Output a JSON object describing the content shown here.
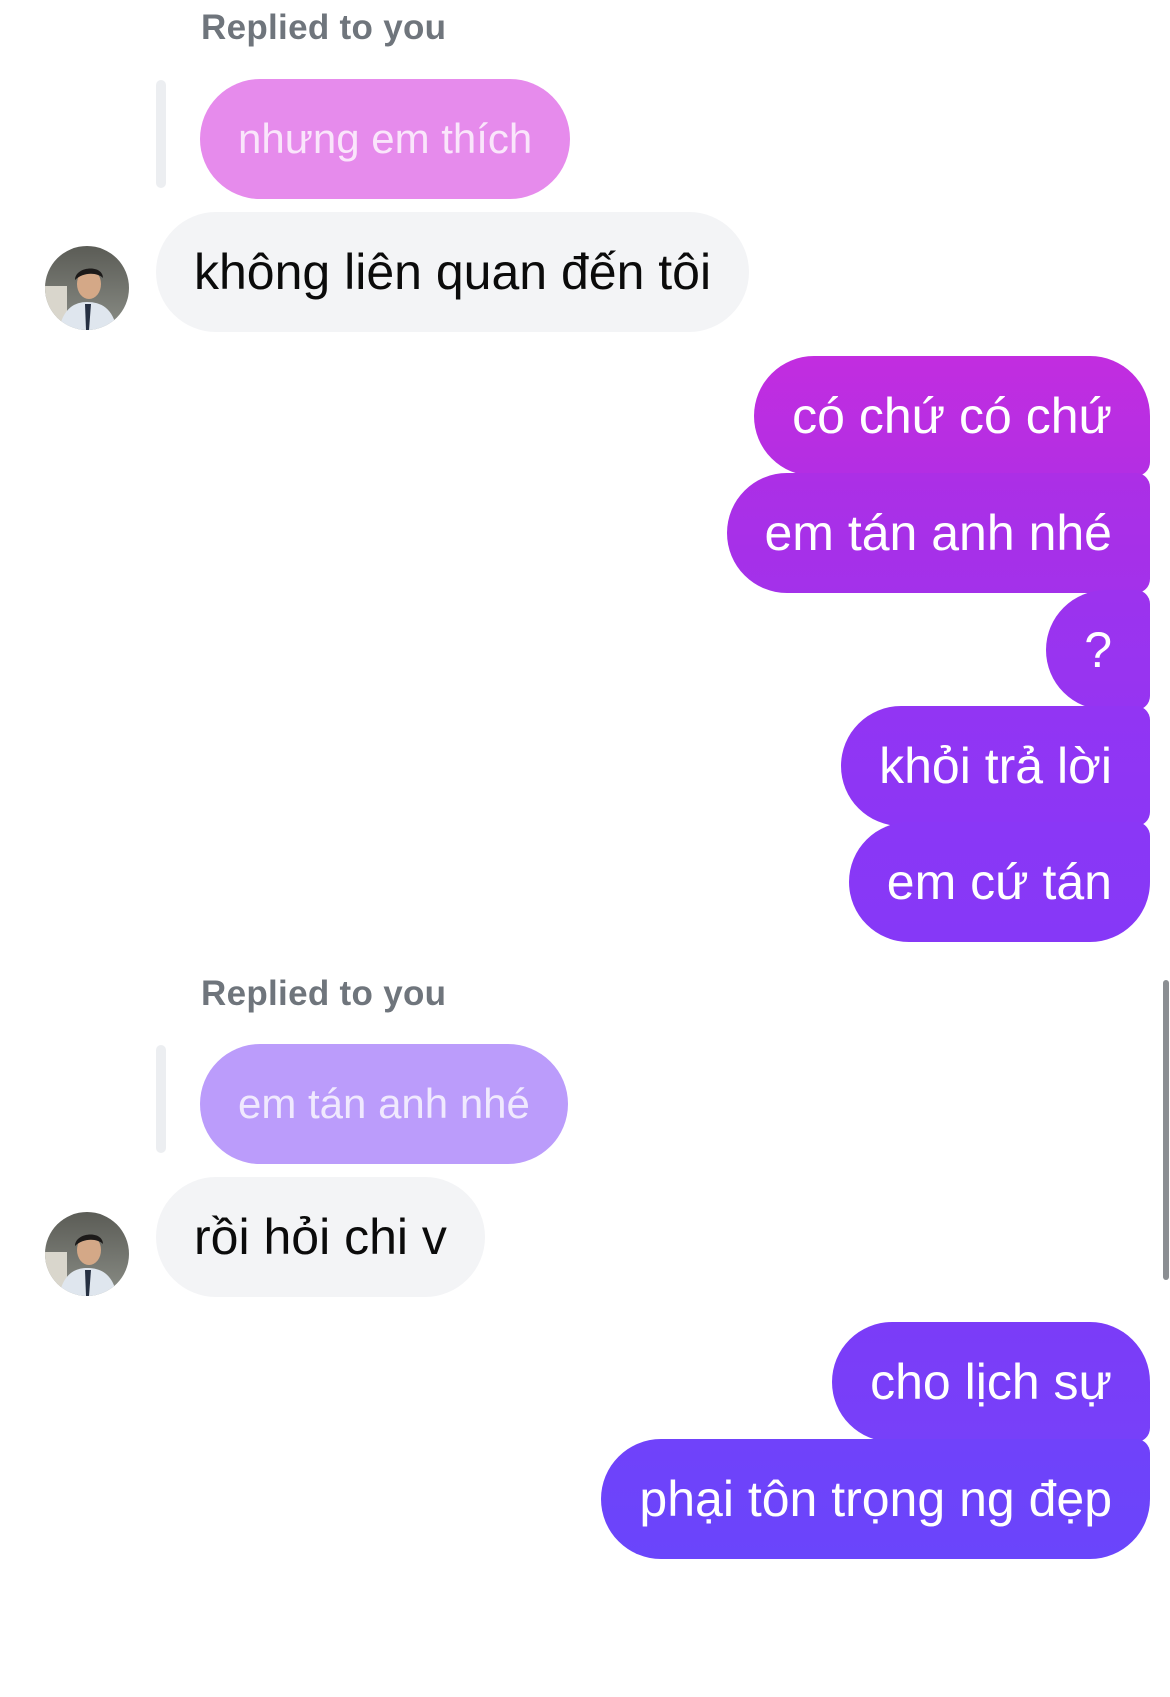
{
  "thread": {
    "reply_context_1": {
      "label": "Replied to you",
      "quoted_text": "nhưng em thích"
    },
    "received_1": "không liên quan đến tôi",
    "sent_group_1": [
      "có chứ có chứ",
      "em tán anh nhé",
      "?",
      "khỏi trả lời",
      "em cứ tán"
    ],
    "reply_context_2": {
      "label": "Replied to you",
      "quoted_text": "em tán anh nhé"
    },
    "received_2": "rồi hỏi chi v",
    "sent_group_2": [
      "cho lịch sự",
      "phại tôn trọng ng đẹp"
    ]
  },
  "contact": {
    "avatar_icon": "profile-photo-icon"
  },
  "colors": {
    "sent_gradient_top": "#c22de0",
    "sent_gradient_bottom": "#6a45fb",
    "received_bubble": "#f3f4f6",
    "quoted_bubble_1": "#e68bec",
    "quoted_bubble_2": "#bb9cfb",
    "reply_label": "#6f757c"
  }
}
